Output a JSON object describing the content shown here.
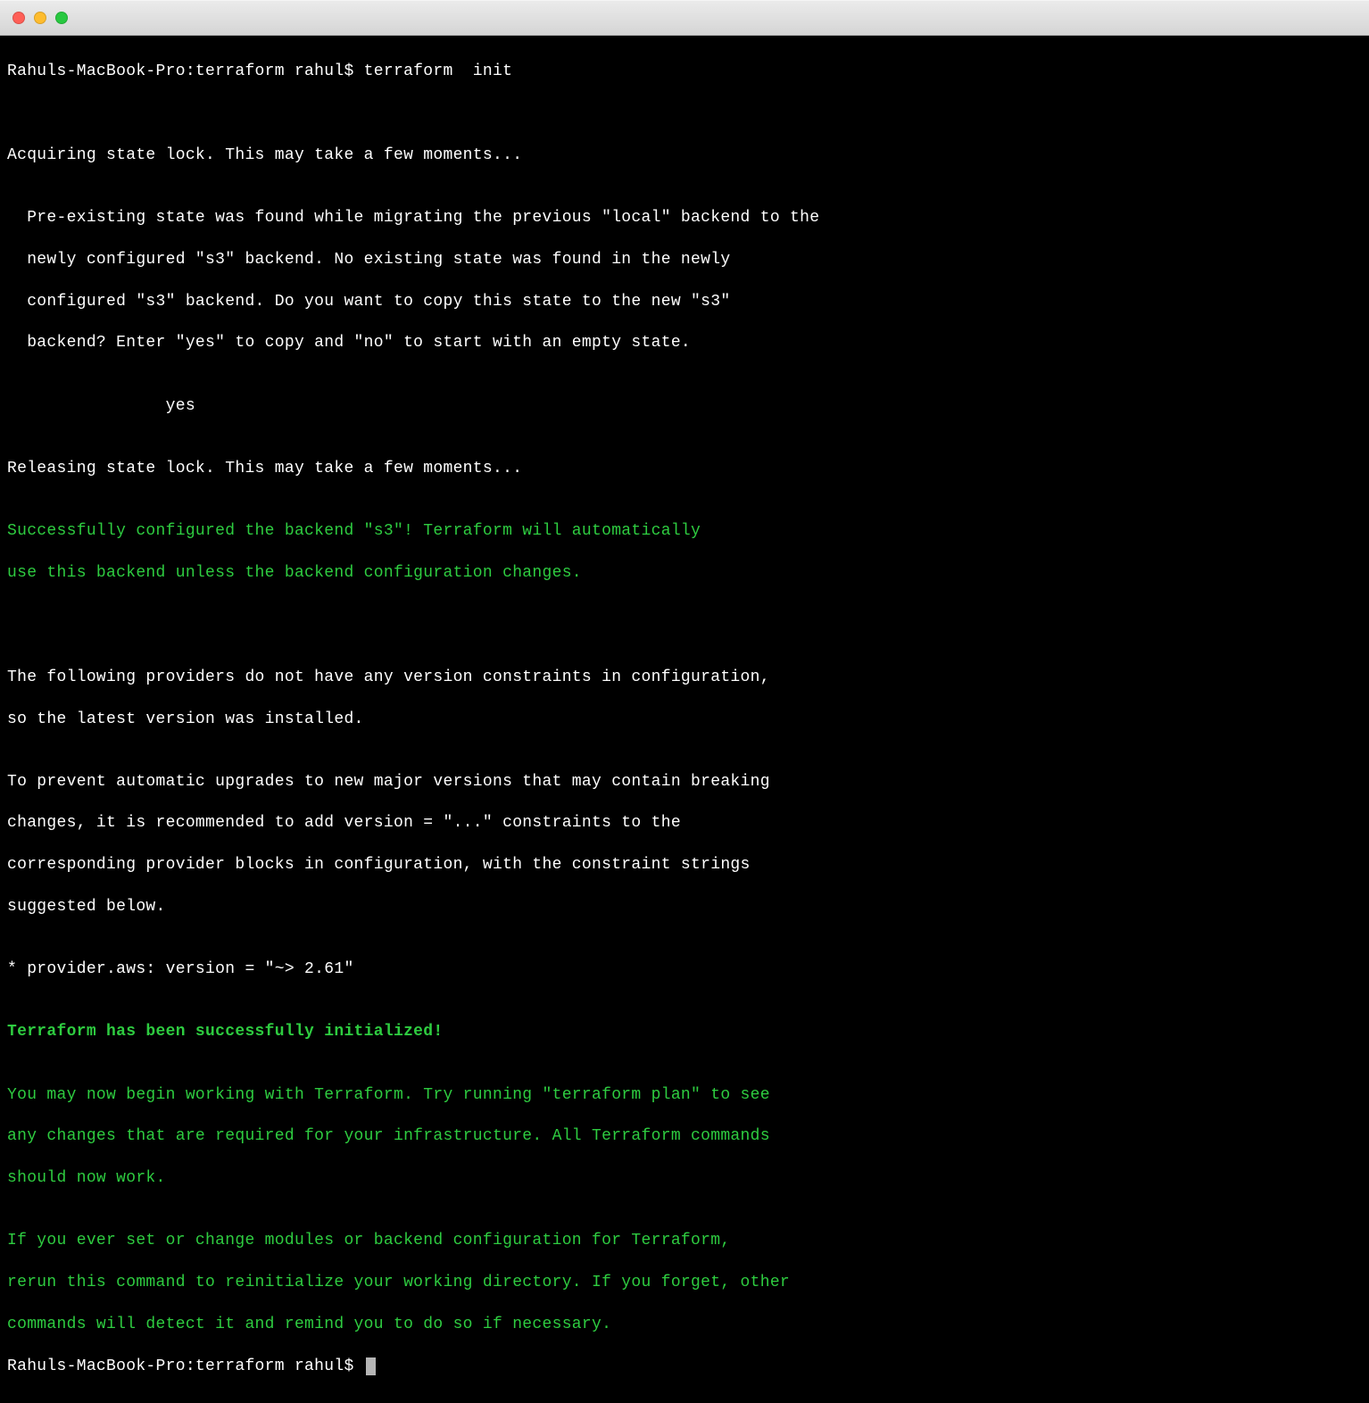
{
  "prompt1": "Rahuls-MacBook-Pro:terraform rahul$ ",
  "command": "terraform  init",
  "blank": "",
  "acquiring": "Acquiring state lock. This may take a few moments...",
  "preexist1": "  Pre-existing state was found while migrating the previous \"local\" backend to the",
  "preexist2": "  newly configured \"s3\" backend. No existing state was found in the newly",
  "preexist3": "  configured \"s3\" backend. Do you want to copy this state to the new \"s3\"",
  "preexist4": "  backend? Enter \"yes\" to copy and \"no\" to start with an empty state.",
  "yesline": "                yes",
  "releasing": "Releasing state lock. This may take a few moments...",
  "success1": "Successfully configured the backend \"s3\"! Terraform will automatically",
  "success2": "use this backend unless the backend configuration changes.",
  "providers1": "The following providers do not have any version constraints in configuration,",
  "providers2": "so the latest version was installed.",
  "prevent1": "To prevent automatic upgrades to new major versions that may contain breaking",
  "prevent2": "changes, it is recommended to add version = \"...\" constraints to the",
  "prevent3": "corresponding provider blocks in configuration, with the constraint strings",
  "prevent4": "suggested below.",
  "provideraws": "* provider.aws: version = \"~> 2.61\"",
  "initialized": "Terraform has been successfully initialized!",
  "maynow1": "You may now begin working with Terraform. Try running \"terraform plan\" to see",
  "maynow2": "any changes that are required for your infrastructure. All Terraform commands",
  "maynow3": "should now work.",
  "ifever1": "If you ever set or change modules or backend configuration for Terraform,",
  "ifever2": "rerun this command to reinitialize your working directory. If you forget, other",
  "ifever3": "commands will detect it and remind you to do so if necessary.",
  "prompt2": "Rahuls-MacBook-Pro:terraform rahul$ "
}
